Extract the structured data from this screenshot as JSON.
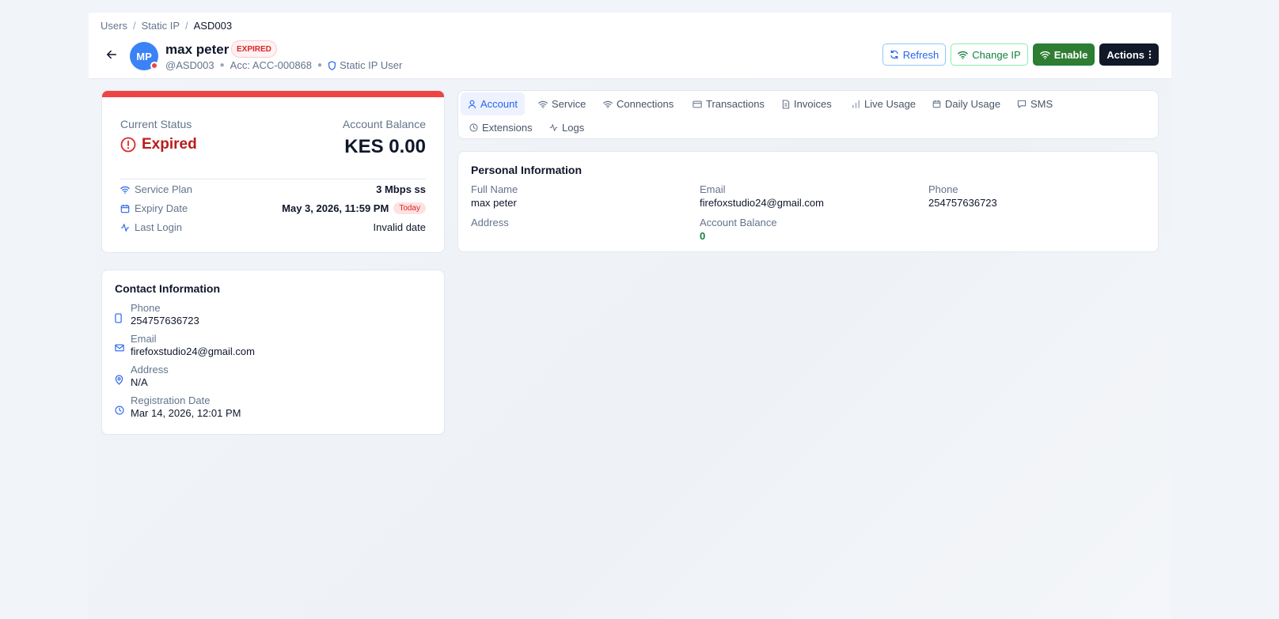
{
  "breadcrumb": {
    "items": [
      "Users",
      "Static IP",
      "ASD003"
    ],
    "separator": "/"
  },
  "user": {
    "initials": "MP",
    "name": "max peter",
    "status_badge": "EXPIRED",
    "handle": "@ASD003",
    "account": "Acc: ACC-000868",
    "role": "Static IP User"
  },
  "actions": {
    "refresh": "Refresh",
    "change_ip": "Change IP",
    "enable": "Enable",
    "actions": "Actions"
  },
  "status_card": {
    "status_label": "Current Status",
    "status_value": "Expired",
    "balance_label": "Account Balance",
    "balance_value": "KES 0.00",
    "rows": {
      "plan_label": "Service Plan",
      "plan_value": "3 Mbps ss",
      "expiry_label": "Expiry Date",
      "expiry_value": "May 3, 2026, 11:59 PM",
      "expiry_badge": "Today",
      "login_label": "Last Login",
      "login_value": "Invalid date"
    }
  },
  "contact": {
    "title": "Contact Information",
    "phone_label": "Phone",
    "phone_value": "254757636723",
    "email_label": "Email",
    "email_value": "firefoxstudio24@gmail.com",
    "address_label": "Address",
    "address_value": "N/A",
    "reg_label": "Registration Date",
    "reg_value": "Mar 14, 2026, 12:01 PM"
  },
  "tabs": {
    "account": "Account",
    "service": "Service",
    "connections": "Connections",
    "transactions": "Transactions",
    "invoices": "Invoices",
    "live_usage": "Live Usage",
    "daily_usage": "Daily Usage",
    "sms": "SMS",
    "extensions": "Extensions",
    "logs": "Logs",
    "active": "Account"
  },
  "personal": {
    "title": "Personal Information",
    "full_name_label": "Full Name",
    "full_name_value": "max peter",
    "email_label": "Email",
    "email_value": "firefoxstudio24@gmail.com",
    "phone_label": "Phone",
    "phone_value": "254757636723",
    "address_label": "Address",
    "address_value": "",
    "balance_label": "Account Balance",
    "balance_value": "0"
  },
  "colors": {
    "accent_blue": "#2563eb",
    "danger_red": "#ef4444",
    "success_green": "#2e7d32",
    "dark": "#111827"
  }
}
